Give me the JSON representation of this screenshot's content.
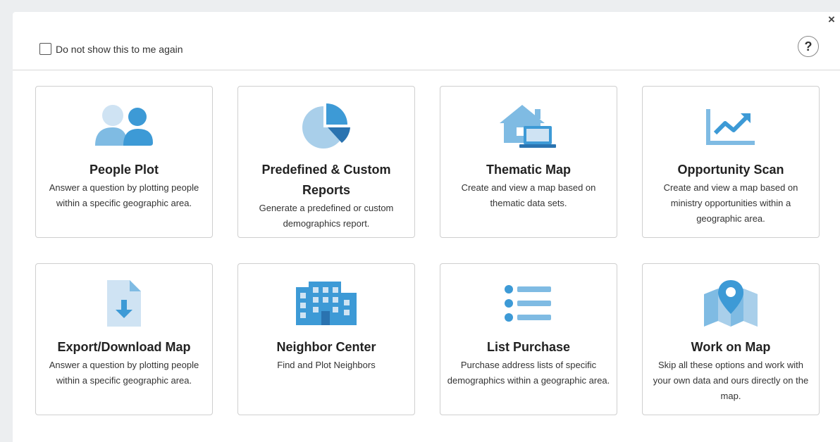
{
  "header": {
    "dont_show_label": "Do not show this to me again",
    "help_glyph": "?",
    "close_glyph": "×"
  },
  "colors": {
    "icon_light": "#b9d7ec",
    "icon_mid": "#7fbbe3",
    "icon_main": "#3d9ad6",
    "icon_dark": "#2a73b0"
  },
  "cards": [
    {
      "title": "People Plot",
      "desc": "Answer a question by plotting people within a specific geographic area.",
      "icon": "people-icon"
    },
    {
      "title": "Predefined & Custom Reports",
      "desc": "Generate a predefined or custom demographics report.",
      "icon": "pie-chart-icon"
    },
    {
      "title": "Thematic Map",
      "desc": "Create and view a map based on thematic data sets.",
      "icon": "house-laptop-icon"
    },
    {
      "title": "Opportunity Scan",
      "desc": "Create and view a map based on ministry opportunities within a geographic area.",
      "icon": "trend-chart-icon"
    },
    {
      "title": "Export/Download Map",
      "desc": "Answer a question by plotting people within a specific geographic area.",
      "icon": "download-file-icon"
    },
    {
      "title": "Neighbor Center",
      "desc": "Find and Plot Neighbors",
      "icon": "building-icon"
    },
    {
      "title": "List Purchase",
      "desc": "Purchase address lists of specific demographics within a geographic area.",
      "icon": "list-icon"
    },
    {
      "title": "Work on Map",
      "desc": "Skip all these options and work with your own data and ours directly on the map.",
      "icon": "map-pin-icon"
    }
  ]
}
